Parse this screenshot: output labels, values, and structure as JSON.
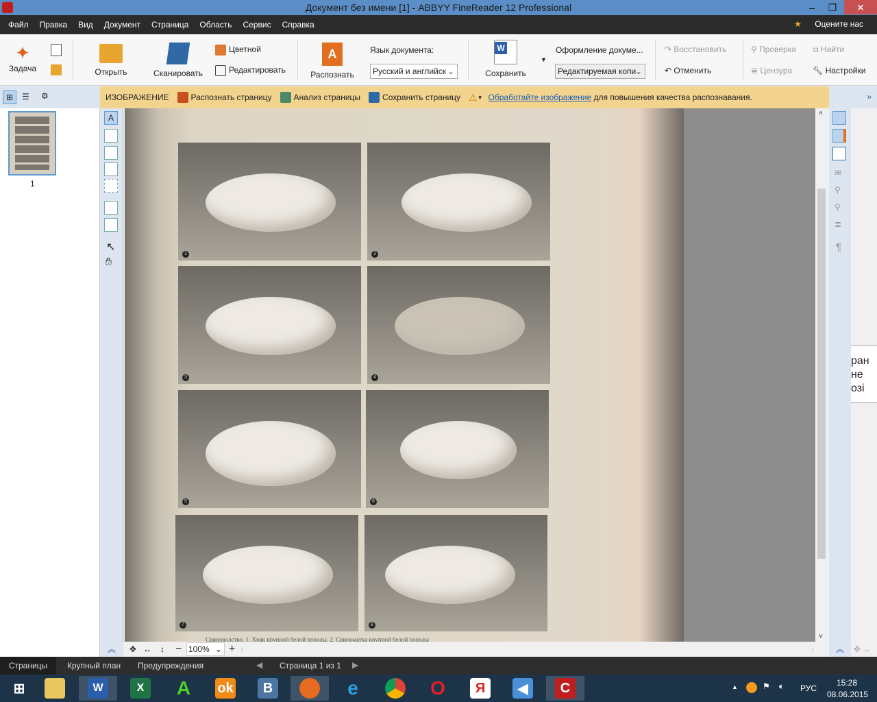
{
  "window": {
    "title": "Документ без имени [1] - ABBYY FineReader 12 Professional",
    "rate_us": "Оцените нас"
  },
  "menu": [
    "Файл",
    "Правка",
    "Вид",
    "Документ",
    "Страница",
    "Область",
    "Сервис",
    "Справка"
  ],
  "ribbon": {
    "task": "Задача",
    "open": "Открыть",
    "scan": "Сканировать",
    "color": "Цветной",
    "edit": "Редактировать",
    "recognize": "Распознать",
    "doc_lang_label": "Язык документа:",
    "doc_lang_value": "Русский и английск",
    "save": "Сохранить",
    "doc_format_label": "Оформление докуме...",
    "doc_format_value": "Редактируемая копи",
    "redo": "Восстановить",
    "undo": "Отменить",
    "check": "Проверка",
    "find": "Найти",
    "censor": "Цензура",
    "settings": "Настройки"
  },
  "imagebar": {
    "title": "ИЗОБРАЖЕНИЕ",
    "recognize_page": "Распознать страницу",
    "analyze_page": "Анализ страницы",
    "save_page": "Сохранить страницу",
    "warning_link": "Обработайте изображение",
    "warning_text": " для повышения качества распознавания.",
    "more": "»"
  },
  "pages": {
    "thumb_label": "1"
  },
  "image": {
    "photo_numbers": [
      "1",
      "2",
      "3",
      "4",
      "5",
      "6",
      "7",
      "8"
    ],
    "caption": "Свиноводство. 1. Хряк крупной белой породы. 2. Свиноматка крупной белой породы"
  },
  "text_panel": {
    "fragments": [
      "ран",
      "не",
      "озі"
    ]
  },
  "zoom": {
    "value": "100%"
  },
  "status": {
    "tabs": [
      "Страницы",
      "Крупный план",
      "Предупреждения"
    ],
    "page_info": "Страница 1 из 1"
  },
  "taskbar": {
    "lang": "РУС",
    "time": "15:28",
    "date": "08.06.2015"
  },
  "colors": {
    "titlebar": "#5b8ec6",
    "imagebar": "#f3d48f",
    "close": "#c75050"
  }
}
